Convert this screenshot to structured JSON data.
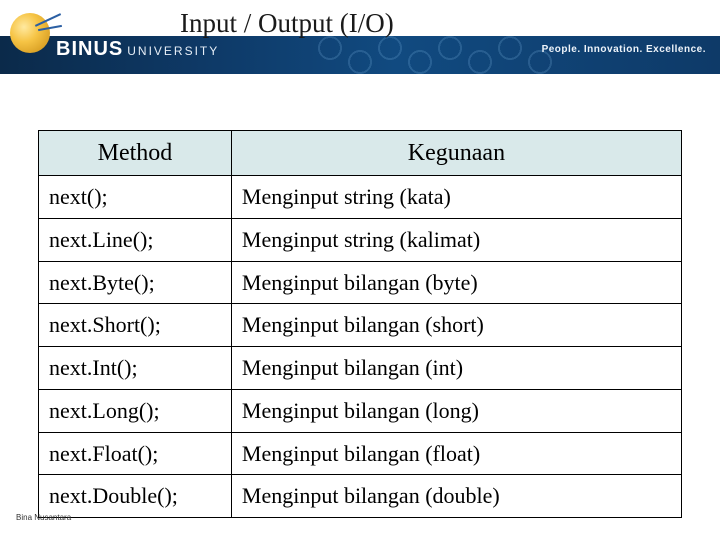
{
  "header": {
    "title": "Input / Output (I/O)",
    "logo": {
      "brand": "BINUS",
      "suffix": "UNIVERSITY"
    },
    "tagline": "People. Innovation. Excellence."
  },
  "table": {
    "headers": {
      "method": "Method",
      "use": "Kegunaan"
    },
    "rows": [
      {
        "method": "next();",
        "use": "Menginput string (kata)"
      },
      {
        "method": "next.Line();",
        "use": "Menginput string (kalimat)"
      },
      {
        "method": "next.Byte();",
        "use": "Menginput bilangan (byte)"
      },
      {
        "method": "next.Short();",
        "use": "Menginput bilangan (short)"
      },
      {
        "method": "next.Int();",
        "use": "Menginput bilangan (int)"
      },
      {
        "method": "next.Long();",
        "use": "Menginput bilangan (long)"
      },
      {
        "method": "next.Float();",
        "use": "Menginput bilangan (float)"
      },
      {
        "method": "next.Double();",
        "use": "Menginput bilangan (double)"
      }
    ]
  },
  "footer": {
    "note": "Bina Nusantara"
  }
}
